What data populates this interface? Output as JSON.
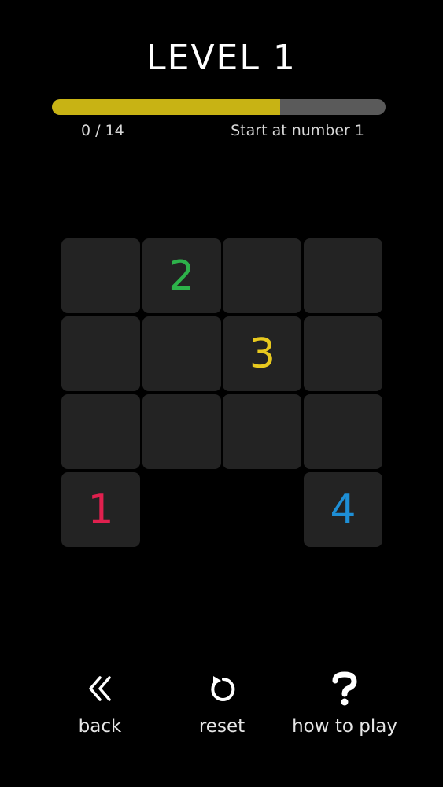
{
  "game": {
    "title": "LEVEL 1",
    "progress": {
      "fraction": 0.685,
      "color": "#c8b314",
      "track_color": "#5a5a5a"
    },
    "counter": "0 / 14",
    "hint": "Start at number 1"
  },
  "grid": {
    "rows": 4,
    "cols": 4,
    "cell_color": "#232323",
    "cells": [
      {
        "row": 0,
        "col": 0,
        "label": "",
        "color": ""
      },
      {
        "row": 0,
        "col": 1,
        "label": "2",
        "color": "#2db24a"
      },
      {
        "row": 0,
        "col": 2,
        "label": "",
        "color": ""
      },
      {
        "row": 0,
        "col": 3,
        "label": "",
        "color": ""
      },
      {
        "row": 1,
        "col": 0,
        "label": "",
        "color": ""
      },
      {
        "row": 1,
        "col": 1,
        "label": "",
        "color": ""
      },
      {
        "row": 1,
        "col": 2,
        "label": "3",
        "color": "#e8c91e"
      },
      {
        "row": 1,
        "col": 3,
        "label": "",
        "color": ""
      },
      {
        "row": 2,
        "col": 0,
        "label": "",
        "color": ""
      },
      {
        "row": 2,
        "col": 1,
        "label": "",
        "color": ""
      },
      {
        "row": 2,
        "col": 2,
        "label": "",
        "color": ""
      },
      {
        "row": 2,
        "col": 3,
        "label": "",
        "color": ""
      },
      {
        "row": 3,
        "col": 0,
        "label": "1",
        "color": "#e0204e"
      },
      {
        "row": 3,
        "col": 3,
        "label": "4",
        "color": "#1e8fd6"
      }
    ]
  },
  "controls": {
    "back": {
      "label": "back",
      "icon": "double-chevron-left-icon"
    },
    "reset": {
      "label": "reset",
      "icon": "reset-arrow-icon"
    },
    "how_to_play": {
      "label": "how to play",
      "icon": "question-mark-icon"
    }
  }
}
